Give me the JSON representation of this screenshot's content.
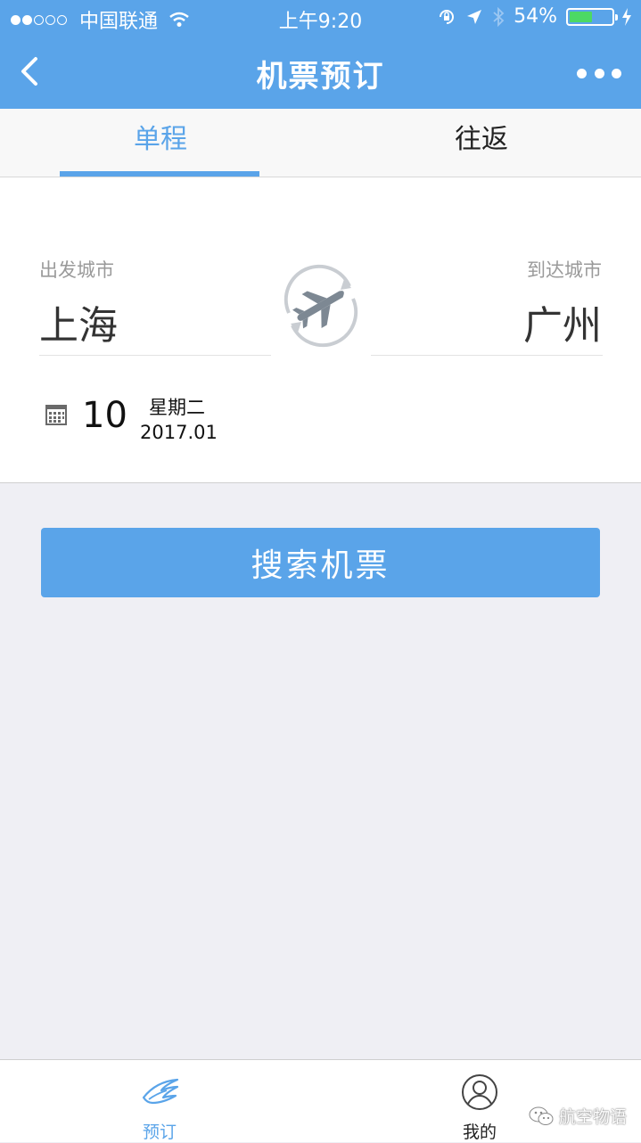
{
  "status_bar": {
    "carrier": "中国联通",
    "time": "上午9:20",
    "battery_percent": "54%",
    "battery_level": 0.54
  },
  "navbar": {
    "title": "机票预订"
  },
  "tabs": [
    {
      "label": "单程",
      "active": true
    },
    {
      "label": "往返",
      "active": false
    }
  ],
  "departure": {
    "label": "出发城市",
    "city": "上海"
  },
  "arrival": {
    "label": "到达城市",
    "city": "广州"
  },
  "date": {
    "day": "10",
    "weekday": "星期二",
    "year_month": "2017.01"
  },
  "search_button": {
    "label": "搜索机票"
  },
  "tabbar": {
    "items": [
      {
        "label": "预订",
        "icon": "swallow-logo-icon",
        "active": true
      },
      {
        "label": "我的",
        "icon": "user-icon",
        "active": false
      }
    ]
  },
  "watermark": {
    "text": "航空物语"
  },
  "colors": {
    "accent": "#5aa4e9",
    "background": "#efeff4",
    "battery": "#4cd964"
  }
}
